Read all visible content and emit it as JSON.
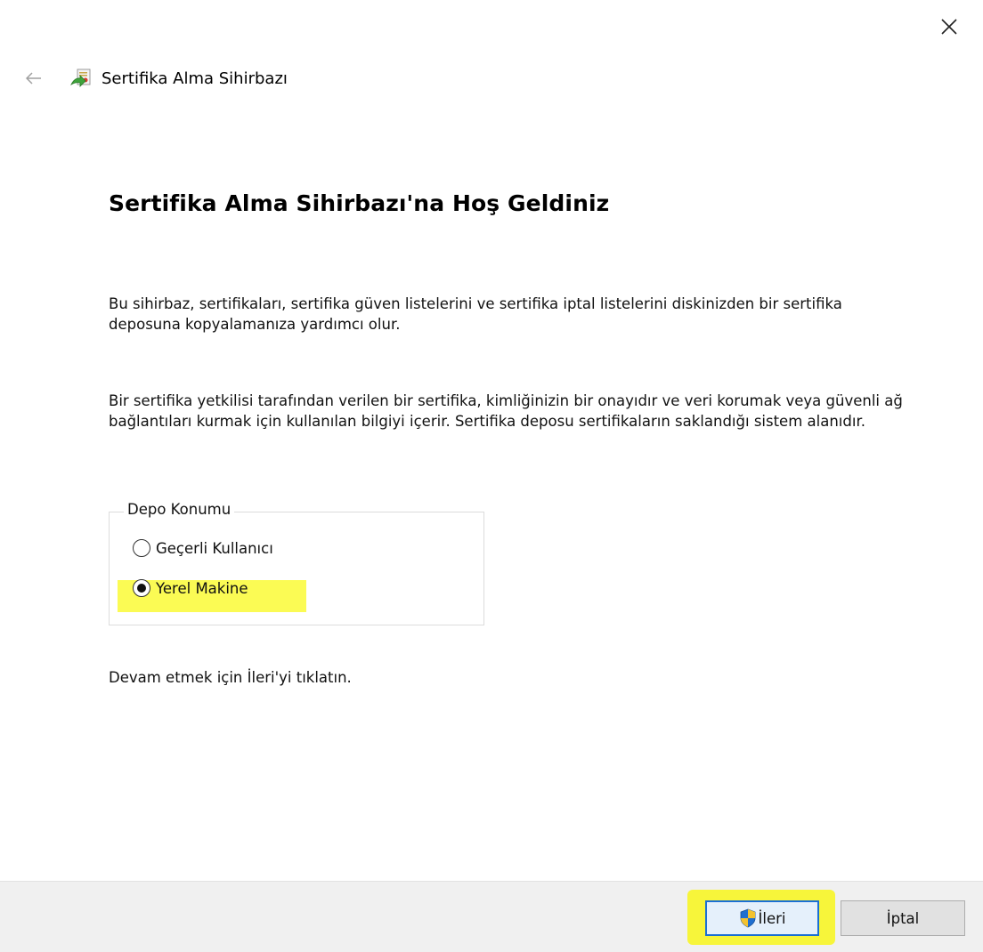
{
  "window": {
    "title": "Sertifika Alma Sihirbazı"
  },
  "content": {
    "heading": "Sertifika Alma Sihirbazı'na Hoş Geldiniz",
    "paragraph1": "Bu sihirbaz, sertifikaları, sertifika güven listelerini ve sertifika iptal listelerini diskinizden bir sertifika deposuna kopyalamanıza yardımcı olur.",
    "paragraph2": "Bir sertifika yetkilisi tarafından verilen bir sertifika, kimliğinizin bir onayıdır ve veri korumak veya güvenli ağ bağlantıları kurmak için kullanılan bilgiyi içerir. Sertifika deposu sertifikaların saklandığı sistem alanıdır.",
    "store_location": {
      "legend": "Depo Konumu",
      "options": [
        {
          "label": "Geçerli Kullanıcı",
          "selected": false
        },
        {
          "label": "Yerel Makine",
          "selected": true
        }
      ]
    },
    "hint": "Devam etmek için İleri'yi tıklatın."
  },
  "footer": {
    "next_label": "İleri",
    "cancel_label": "İptal"
  },
  "colors": {
    "highlight": "#fbfb54",
    "focus_border": "#1a6fd4",
    "footer_bg": "#f0f0f0"
  },
  "icons": {
    "close": "close-icon",
    "back": "back-arrow-icon",
    "wizard": "certificate-wizard-icon",
    "uac_shield": "uac-shield-icon"
  }
}
